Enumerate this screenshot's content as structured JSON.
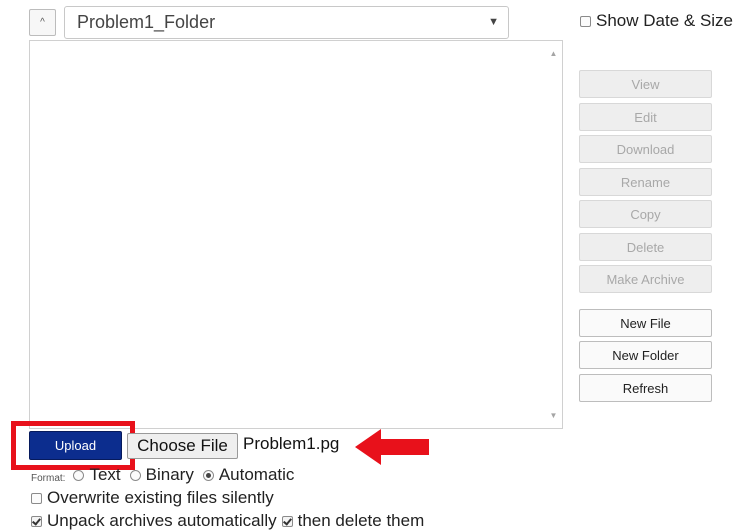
{
  "header": {
    "up_glyph": "^",
    "folder_select": "Problem1_Folder",
    "dropdown_glyph": "▼",
    "show_date_size_label": "Show Date & Size",
    "show_date_size_checked": false
  },
  "file_list": {
    "items": [],
    "scroll_up_glyph": "▲",
    "scroll_down_glyph": "▼"
  },
  "actions": {
    "view": "View",
    "edit": "Edit",
    "download": "Download",
    "rename": "Rename",
    "copy": "Copy",
    "delete": "Delete",
    "make_archive": "Make Archive",
    "new_file": "New File",
    "new_folder": "New Folder",
    "refresh": "Refresh"
  },
  "upload": {
    "upload_label": "Upload",
    "choose_file_label": "Choose File",
    "selected_file": "Problem1.pg"
  },
  "format": {
    "label": "Format:",
    "options": [
      "Text",
      "Binary",
      "Automatic"
    ],
    "selected": "Automatic"
  },
  "options": {
    "overwrite_label": "Overwrite existing files silently",
    "overwrite_checked": false,
    "unpack_label": "Unpack archives automatically",
    "unpack_checked": true,
    "delete_after_label": "then delete them",
    "delete_after_checked": true
  },
  "colors": {
    "upload_button": "#0c2d8e",
    "highlight": "#e8111b",
    "arrow": "#e8111b"
  }
}
